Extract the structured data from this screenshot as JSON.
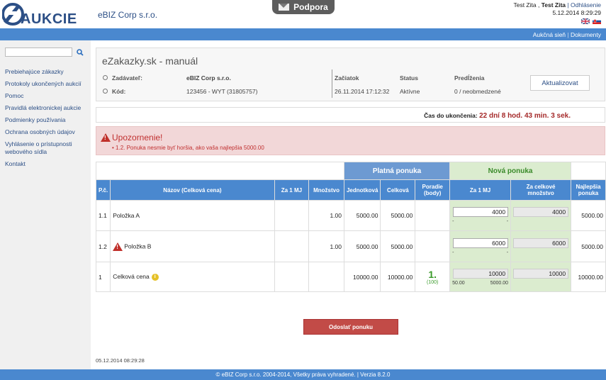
{
  "header": {
    "logo_text": "AUKCIE",
    "company": "eBIZ Corp s.r.o.",
    "support": "Podpora",
    "user_first": "Test Zita",
    "user_bold": "Test Zita",
    "logout": "Odhlásenie",
    "datetime": "5.12.2014 8:29:29"
  },
  "bluebar": {
    "link1": "Aukčná sieň",
    "link2": "Dokumenty",
    "sep": "|"
  },
  "sidebar": {
    "search_value": "",
    "items": [
      "Prebiehajúce zákazky",
      "Protokoly ukončených aukcií",
      "Pomoc",
      "Pravidlá elektronickej aukcie",
      "Podmienky používania",
      "Ochrana osobných údajov",
      "Vyhlásenie o prístupnosti webového sídla",
      "Kontakt"
    ]
  },
  "info": {
    "title": "eZakazky.sk - manuál",
    "zadavatel_label": "Zadávateľ:",
    "zadavatel": "eBIZ Corp s.r.o.",
    "kod_label": "Kód:",
    "kod": "123456 - WYT  (31805757)",
    "zaciatok_label": "Začiatok",
    "zaciatok": "26.11.2014 17:12:32",
    "status_label": "Status",
    "status": "Aktívne",
    "predlzenia_label": "Predĺženia",
    "predlzenia": "0 / neobmedzené",
    "update": "Aktualizovat"
  },
  "timer": {
    "label": "Čas do ukončenia:",
    "value": "22 dní 8 hod. 43 min. 3 sek."
  },
  "warning": {
    "title": "Upozornenie!",
    "message": "1.2. Ponuka nesmie byť horšia, ako vaša najlepšia 5000.00"
  },
  "table": {
    "group_valid": "Platná ponuka",
    "group_new": "Nová ponuka",
    "headers": {
      "pc": "P.č.",
      "name": "Názov (Celková cena)",
      "per_mj": "Za 1 MJ",
      "qty": "Množstvo",
      "unit": "Jednotková",
      "total": "Celková",
      "rank": "Poradie (body)",
      "new_per_mj": "Za 1 MJ",
      "new_total": "Za celkové množstvo",
      "best": "Najlepšia ponuka"
    },
    "rows": [
      {
        "pc": "1.1",
        "name": "Položka A",
        "qty": "1.00",
        "unit": "5000.00",
        "total": "5000.00",
        "new_per_mj": "4000",
        "new_total": "4000",
        "best": "5000.00",
        "dash1": "-",
        "dash2": "-"
      },
      {
        "pc": "1.2",
        "name": "Položka B",
        "qty": "1.00",
        "unit": "5000.00",
        "total": "5000.00",
        "new_per_mj": "6000",
        "new_total": "6000",
        "best": "5000.00",
        "dash1": "-",
        "dash2": "-"
      },
      {
        "pc": "1",
        "name": "Celková cena",
        "unit": "10000.00",
        "total": "10000.00",
        "rank": "1.",
        "rank_points": "(100)",
        "new_per_mj": "10000",
        "new_total": "10000",
        "best": "10000.00",
        "sub1": "50.00",
        "sub2": "5000.00"
      }
    ]
  },
  "send": "Odoslať ponuku",
  "timestamp": "05.12.2014 08:29:28",
  "footer": "© eBIZ Corp s.r.o. 2004-2014, Všetky práva vyhradené. | Verzia 8.2.0",
  "colors": {
    "brand_blue": "#4a88cf",
    "alert_red": "#c03030",
    "green": "#3a9a2a"
  }
}
